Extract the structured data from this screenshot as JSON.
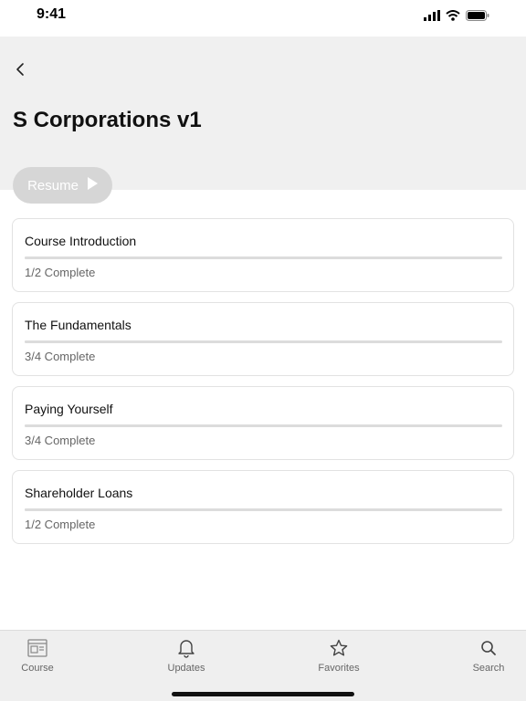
{
  "status_bar": {
    "time": "9:41"
  },
  "header": {
    "title": "S Corporations v1",
    "resume_label": "Resume"
  },
  "lessons": [
    {
      "title": "Course Introduction",
      "status": "1/2 Complete",
      "progress": 0.5
    },
    {
      "title": "The Fundamentals",
      "status": "3/4 Complete",
      "progress": 0.75
    },
    {
      "title": "Paying Yourself",
      "status": "3/4 Complete",
      "progress": 0.75
    },
    {
      "title": "Shareholder Loans",
      "status": "1/2 Complete",
      "progress": 0.5
    }
  ],
  "tabs": [
    {
      "label": "Course",
      "icon": "course-icon"
    },
    {
      "label": "Updates",
      "icon": "bell-icon"
    },
    {
      "label": "Favorites",
      "icon": "star-icon"
    },
    {
      "label": "Search",
      "icon": "search-icon"
    }
  ],
  "colors": {
    "header_bg": "#f0f0f0",
    "resume_bg": "#d6d6d6",
    "progress": "#dcdcdc",
    "tab_bar_bg": "#efefef"
  }
}
